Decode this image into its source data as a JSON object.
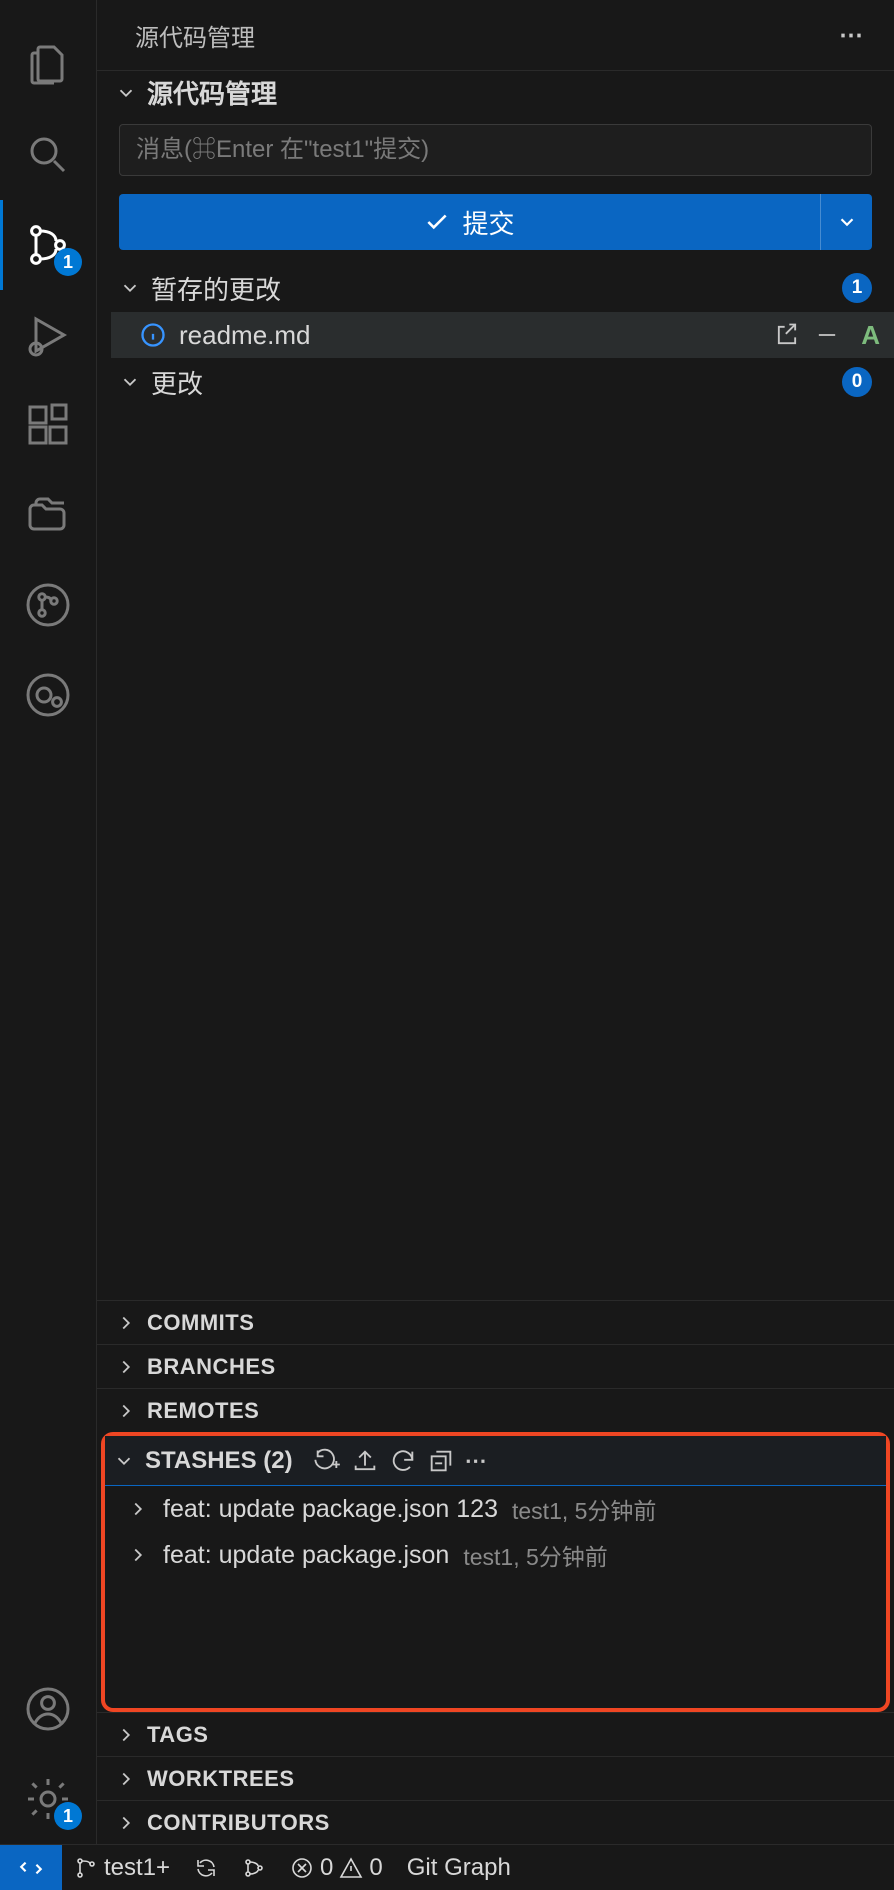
{
  "panel": {
    "title": "源代码管理",
    "scm_section_title": "源代码管理",
    "message_placeholder": "消息(⌘Enter 在\"test1\"提交)",
    "commit_label": "提交"
  },
  "activity": {
    "scm_badge": "1",
    "settings_badge": "1"
  },
  "groups": {
    "staged": {
      "label": "暂存的更改",
      "count": "1"
    },
    "changes": {
      "label": "更改",
      "count": "0"
    }
  },
  "staged_files": [
    {
      "name": "readme.md",
      "status": "A"
    }
  ],
  "sections": {
    "commits": "COMMITS",
    "branches": "BRANCHES",
    "remotes": "REMOTES",
    "stashes": "STASHES (2)",
    "tags": "TAGS",
    "worktrees": "WORKTREES",
    "contributors": "CONTRIBUTORS"
  },
  "stashes": [
    {
      "msg": "feat: update package.json 123",
      "meta": "test1, 5分钟前"
    },
    {
      "msg": "feat: update package.json",
      "meta": "test1, 5分钟前"
    }
  ],
  "status": {
    "branch": "test1+",
    "errors": "0",
    "warnings": "0",
    "git_graph": "Git Graph"
  }
}
